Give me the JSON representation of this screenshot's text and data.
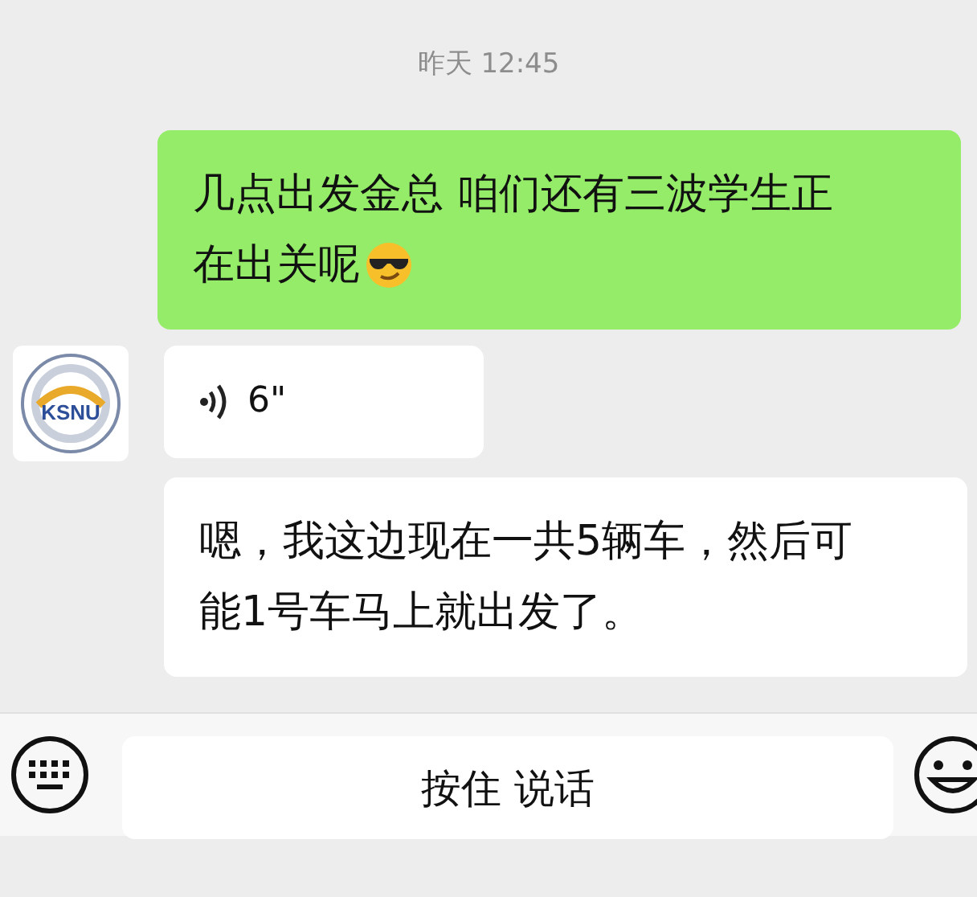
{
  "timestamp": "昨天 12:45",
  "messages": [
    {
      "kind": "text",
      "outgoing": true,
      "lines": [
        "几点出发金总 咱们还有三波学生正",
        "在出关呢"
      ],
      "emoji": true
    },
    {
      "kind": "voice",
      "outgoing": false,
      "avatar_text": "KSNU",
      "duration": "6\""
    },
    {
      "kind": "text",
      "outgoing": false,
      "lines": [
        "嗯，我这边现在一共5辆车，然后可",
        "能1号车马上就出发了。"
      ],
      "emoji": false
    }
  ],
  "input_bar": {
    "hold_to_talk": "按住 说话"
  }
}
